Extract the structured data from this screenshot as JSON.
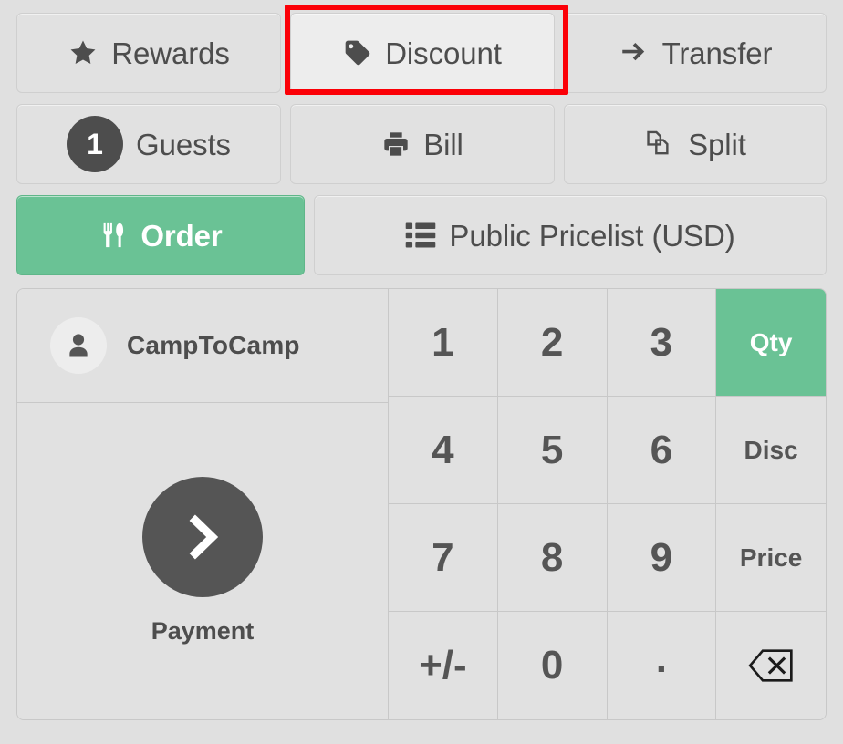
{
  "theme": {
    "background": "#e0e0e0",
    "button_bg": "#e1e1e1",
    "button_hover_bg": "#ededed",
    "border": "#c8c8c8",
    "text": "#4d4d4d",
    "accent_green": "#6ac295",
    "highlight_red": "#fb0007",
    "dark_circle": "#555555"
  },
  "actions": {
    "rewards": {
      "label": "Rewards",
      "icon": "star-icon"
    },
    "discount": {
      "label": "Discount",
      "icon": "tag-icon",
      "state": "hovered",
      "highlighted": true
    },
    "transfer": {
      "label": "Transfer",
      "icon": "arrow-right-icon"
    },
    "guests": {
      "label": "Guests",
      "icon": "guest-count-badge",
      "count": "1"
    },
    "bill": {
      "label": "Bill",
      "icon": "printer-icon"
    },
    "split": {
      "label": "Split",
      "icon": "split-documents-icon"
    },
    "order": {
      "label": "Order",
      "icon": "cutlery-icon",
      "state": "active"
    },
    "pricelist": {
      "label": "Public Pricelist (USD)",
      "icon": "list-icon"
    }
  },
  "customer": {
    "name": "CampToCamp",
    "icon": "person-icon"
  },
  "payment": {
    "label": "Payment",
    "icon": "chevron-right-icon"
  },
  "numpad": {
    "keys": [
      {
        "label": "1",
        "name": "numpad-key-1",
        "type": "digit"
      },
      {
        "label": "2",
        "name": "numpad-key-2",
        "type": "digit"
      },
      {
        "label": "3",
        "name": "numpad-key-3",
        "type": "digit"
      },
      {
        "label": "Qty",
        "name": "numpad-mode-qty",
        "type": "mode",
        "active": true
      },
      {
        "label": "4",
        "name": "numpad-key-4",
        "type": "digit"
      },
      {
        "label": "5",
        "name": "numpad-key-5",
        "type": "digit"
      },
      {
        "label": "6",
        "name": "numpad-key-6",
        "type": "digit"
      },
      {
        "label": "Disc",
        "name": "numpad-mode-disc",
        "type": "mode",
        "active": false
      },
      {
        "label": "7",
        "name": "numpad-key-7",
        "type": "digit"
      },
      {
        "label": "8",
        "name": "numpad-key-8",
        "type": "digit"
      },
      {
        "label": "9",
        "name": "numpad-key-9",
        "type": "digit"
      },
      {
        "label": "Price",
        "name": "numpad-mode-price",
        "type": "mode",
        "active": false
      },
      {
        "label": "+/-",
        "name": "numpad-key-sign",
        "type": "digit"
      },
      {
        "label": "0",
        "name": "numpad-key-0",
        "type": "digit"
      },
      {
        "label": ".",
        "name": "numpad-key-decimal",
        "type": "digit"
      },
      {
        "label": "",
        "name": "numpad-backspace",
        "type": "backspace"
      }
    ]
  }
}
